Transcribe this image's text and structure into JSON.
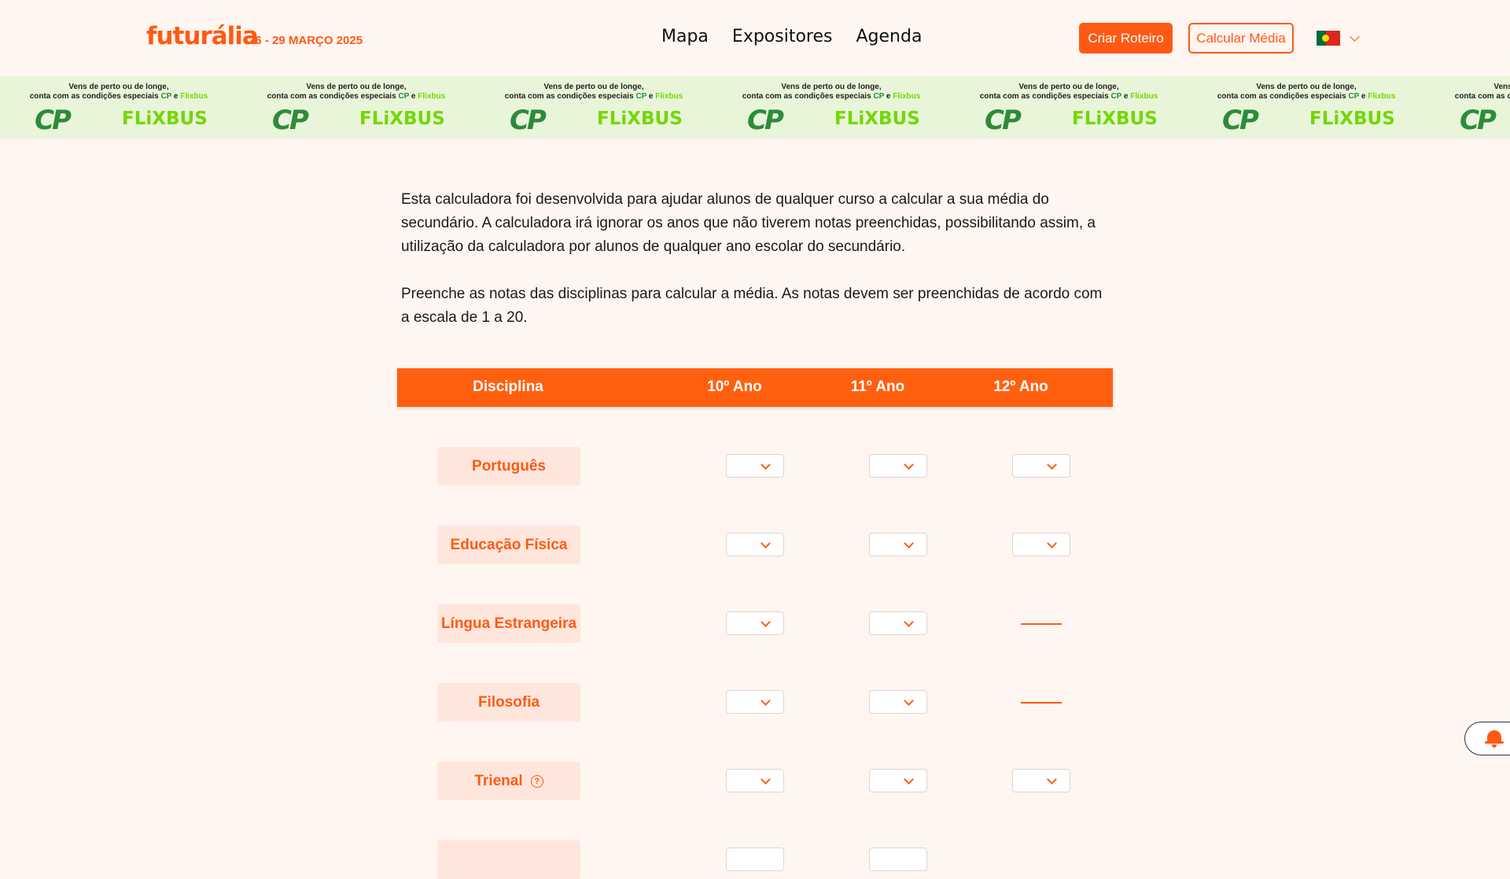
{
  "header": {
    "logo": "futurália",
    "dates": "26 - 29 MARÇO 2025",
    "nav": [
      "Mapa",
      "Expositores",
      "Agenda"
    ],
    "cta_primary": "Criar Roteiro",
    "cta_secondary": "Calcular Média"
  },
  "banner": {
    "line1": "Vens de perto ou de longe,",
    "line2_prefix": "conta com as condições especiais ",
    "cp": "CP",
    "and": " e ",
    "flixbus": "Flixbus",
    "cp_logo": "CP",
    "flixbus_logo": "FLiXBUS"
  },
  "intro": {
    "p1": "Esta calculadora foi desenvolvida para ajudar alunos de qualquer curso a calcular a sua média do secundário. A calculadora irá ignorar os anos que não tiverem notas preenchidas, possibilitando assim, a utilização da calculadora por alunos de qualquer ano escolar do secundário.",
    "p2": "Preenche as notas das disciplinas para calcular a média. As notas devem ser preenchidas de acordo com a escala de 1 a 20."
  },
  "table": {
    "headers": [
      "Disciplina",
      "10º Ano",
      "11º Ano",
      "12º Ano"
    ],
    "rows": [
      {
        "subject": "Português",
        "years": [
          true,
          true,
          true
        ]
      },
      {
        "subject": "Educação Física",
        "years": [
          true,
          true,
          true
        ]
      },
      {
        "subject": "Língua Estrangeira",
        "years": [
          true,
          true,
          false
        ]
      },
      {
        "subject": "Filosofia",
        "years": [
          true,
          true,
          false
        ]
      },
      {
        "subject": "Trienal",
        "years": [
          true,
          true,
          true
        ],
        "help": true
      }
    ]
  },
  "colors": {
    "accent": "#ff5a14",
    "header_bar": "#ff6010",
    "subject_bg": "#ffe6dc",
    "page_bg": "#fff5f1",
    "banner_bg": "#e8f5d9"
  },
  "icons": {
    "help": "question-circle-icon",
    "notification": "bell-icon",
    "select": "chevron-down-icon"
  }
}
